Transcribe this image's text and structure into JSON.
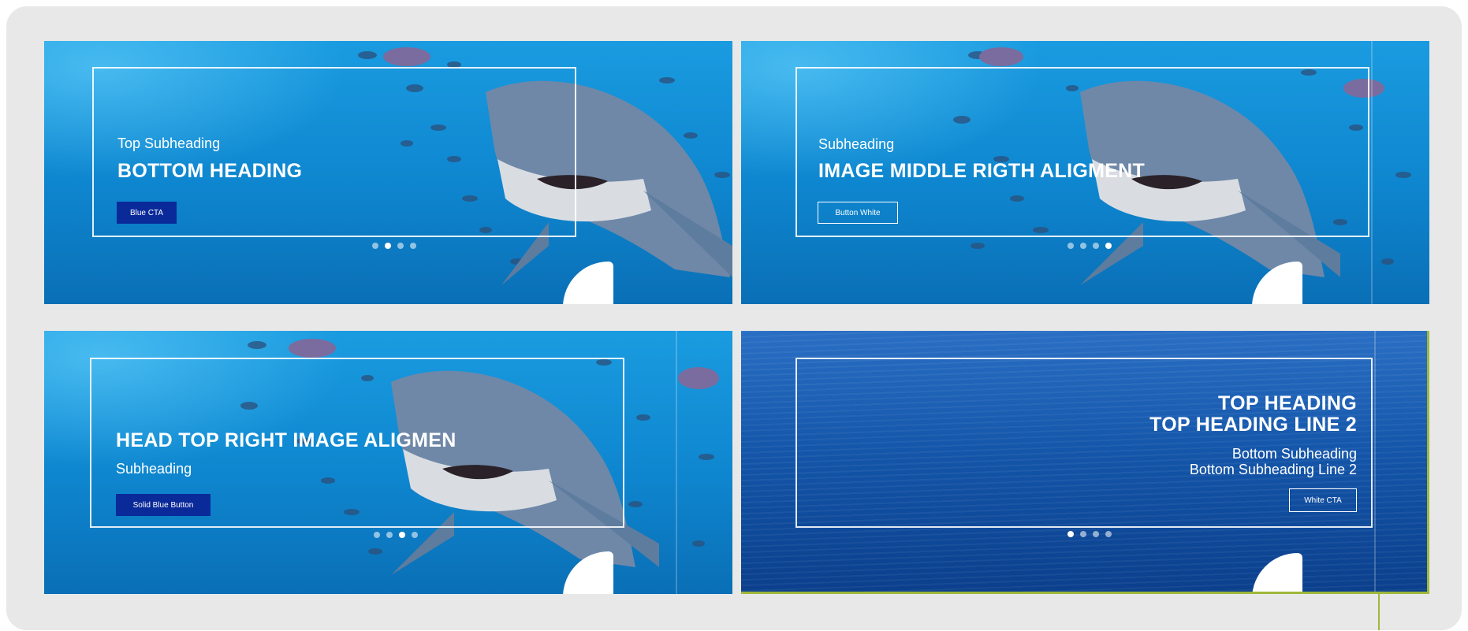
{
  "slides": [
    {
      "background": "shark",
      "subheading": "Top Subheading",
      "heading": "BOTTOM HEADING",
      "cta": "Blue CTA",
      "cta_style": "solid",
      "active_dot": 2,
      "dot_count": 4
    },
    {
      "background": "shark",
      "subheading": "Subheading",
      "heading": "IMAGE MIDDLE RIGTH ALIGMENT",
      "cta": "Button White",
      "cta_style": "outline",
      "active_dot": 4,
      "dot_count": 4
    },
    {
      "background": "shark",
      "heading": "HEAD TOP RIGHT IMAGE ALIGMEN",
      "subheading": "Subheading",
      "cta": "Solid Blue Button",
      "cta_style": "solid",
      "active_dot": 3,
      "dot_count": 4
    },
    {
      "background": "ocean",
      "heading_line1": "TOP HEADING",
      "heading_line2": "TOP HEADING LINE 2",
      "subheading_line1": "Bottom Subheading",
      "subheading_line2": "Bottom Subheading Line 2",
      "cta": "White CTA",
      "cta_style": "outline",
      "active_dot": 1,
      "dot_count": 4
    }
  ],
  "colors": {
    "panel_bg": "#e8e8e8",
    "solid_button": "#0a2a9a",
    "selection_accent": "#9fb83a",
    "ocean_top": "#2a6fc4",
    "shark_water": "#0e86cf"
  }
}
